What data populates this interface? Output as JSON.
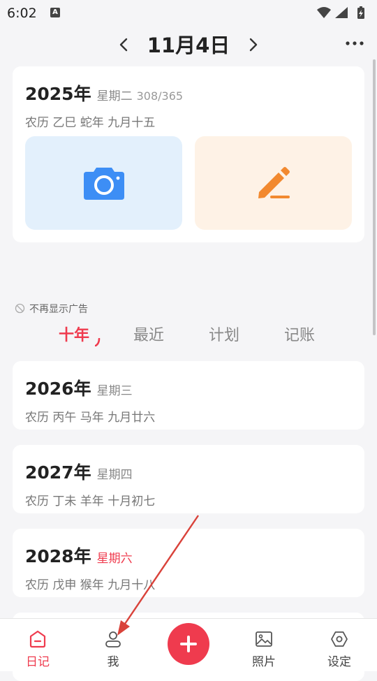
{
  "status_bar": {
    "time": "6:02",
    "notification_badge": "A"
  },
  "header": {
    "date_title": "11月4日"
  },
  "today_card": {
    "year": "2025年",
    "weekday": "星期二",
    "day_count": "308/365",
    "lunar": "农历 乙巳 蛇年 九月十五"
  },
  "ad": {
    "label": "不再显示广告"
  },
  "tabs": [
    {
      "label": "十年"
    },
    {
      "label": "最近"
    },
    {
      "label": "计划"
    },
    {
      "label": "记账"
    }
  ],
  "year_cards": [
    {
      "year": "2026年",
      "weekday": "星期三",
      "lunar": "农历 丙午 马年 九月廿六"
    },
    {
      "year": "2027年",
      "weekday": "星期四",
      "lunar": "农历 丁未 羊年 十月初七"
    },
    {
      "year": "2028年",
      "weekday": "星期六",
      "lunar": "农历 戊申 猴年 九月十八"
    }
  ],
  "bottom_nav": {
    "diary": "日记",
    "me": "我",
    "photos": "照片",
    "settings": "设定"
  },
  "colors": {
    "accent": "#ef3b4e",
    "camera_blue": "#3d8ef5",
    "pencil_orange": "#f2892f",
    "annotation_arrow": "#d9423a"
  }
}
